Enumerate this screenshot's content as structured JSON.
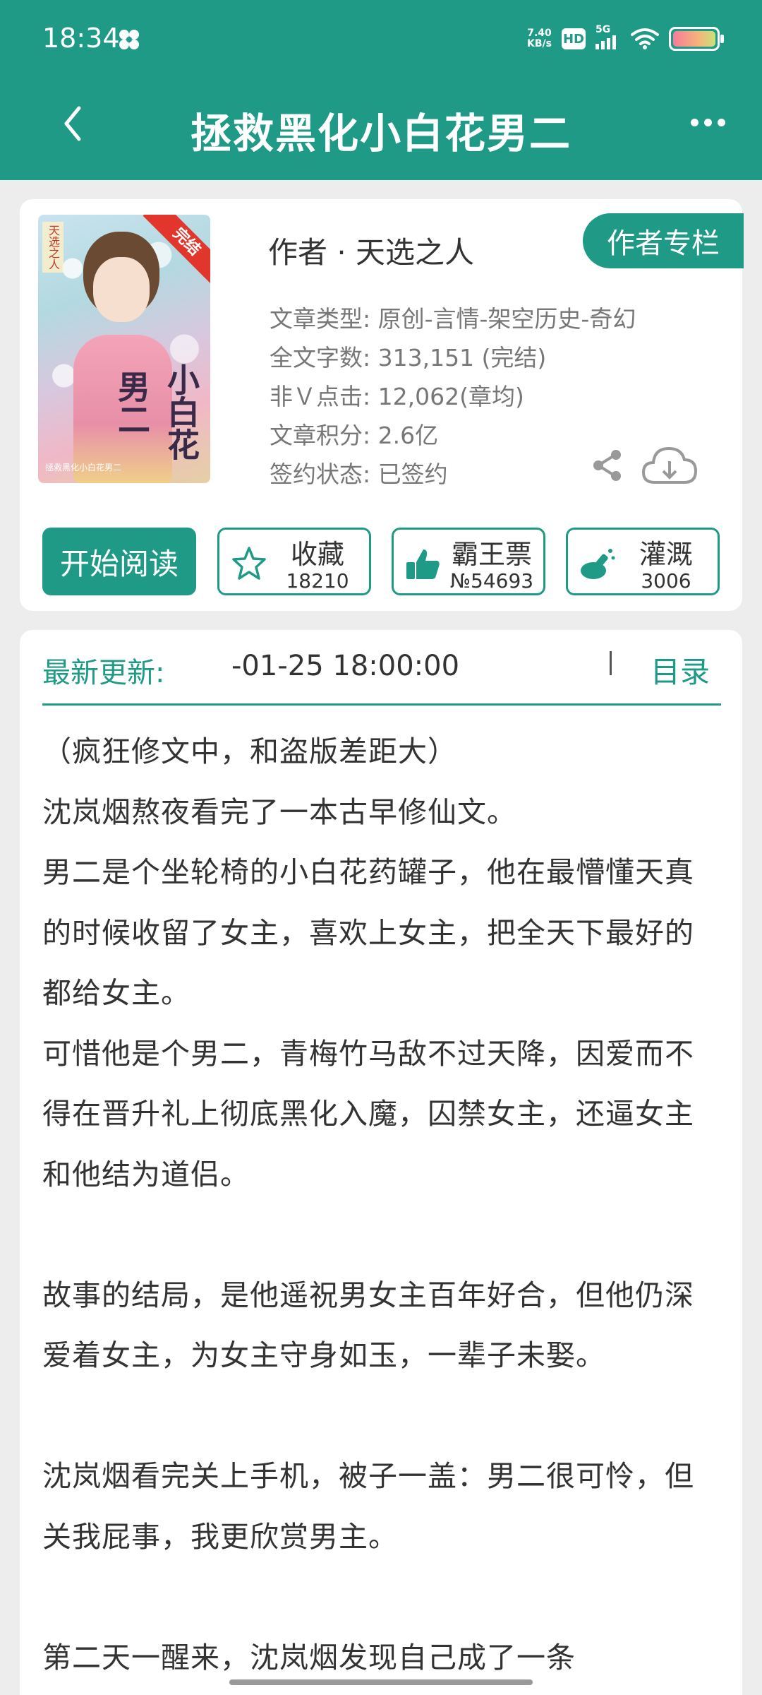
{
  "status_bar": {
    "time": "18:34",
    "net_speed_value": "7.40",
    "net_speed_unit": "KB/s",
    "hd_badge": "HD",
    "network": "5G"
  },
  "header": {
    "title": "拯救黑化小白花男二"
  },
  "book": {
    "author": "作者 · 天选之人",
    "author_column_button": "作者专栏",
    "cover": {
      "badge": "完结",
      "title_main": "小白花",
      "title_side": "男二",
      "author_tag": "天选之人",
      "subline": "拯救黑化小白花男二"
    },
    "meta": [
      "文章类型: 原创-言情-架空历史-奇幻",
      "全文字数: 313,151 (完结)",
      "非Ｖ点击: 12,062(章均)",
      "文章积分: 2.6亿",
      "签约状态: 已签约"
    ]
  },
  "actions": {
    "read_button": "开始阅读",
    "favorite": {
      "label": "收藏",
      "count": "18210"
    },
    "ticket": {
      "label": "霸王票",
      "count": "№54693"
    },
    "nutrient": {
      "label": "灌溉",
      "count": "3006"
    }
  },
  "content": {
    "latest_label": "最新更新:",
    "latest_value": "-01-25 18:00:00",
    "toc_button": "目录",
    "paragraphs": [
      "（疯狂修文中，和盗版差距大）",
      "沈岚烟熬夜看完了一本古早修仙文。",
      "男二是个坐轮椅的小白花药罐子，他在最懵懂天真的时候收留了女主，喜欢上女主，把全天下最好的都给女主。",
      "可惜他是个男二，青梅竹马敌不过天降，因爱而不得在晋升礼上彻底黑化入魔，囚禁女主，还逼女主和他结为道侣。",
      "",
      "故事的结局，是他遥祝男女主百年好合，但他仍深爱着女主，为女主守身如玉，一辈子未娶。",
      "",
      "沈岚烟看完关上手机，被子一盖：男二很可怜，但关我屁事，我更欣赏男主。",
      "",
      "第二天一醒来，沈岚烟发现自己成了一条"
    ]
  },
  "colors": {
    "accent": "#1e9a86",
    "badge_red": "#e2352c"
  }
}
